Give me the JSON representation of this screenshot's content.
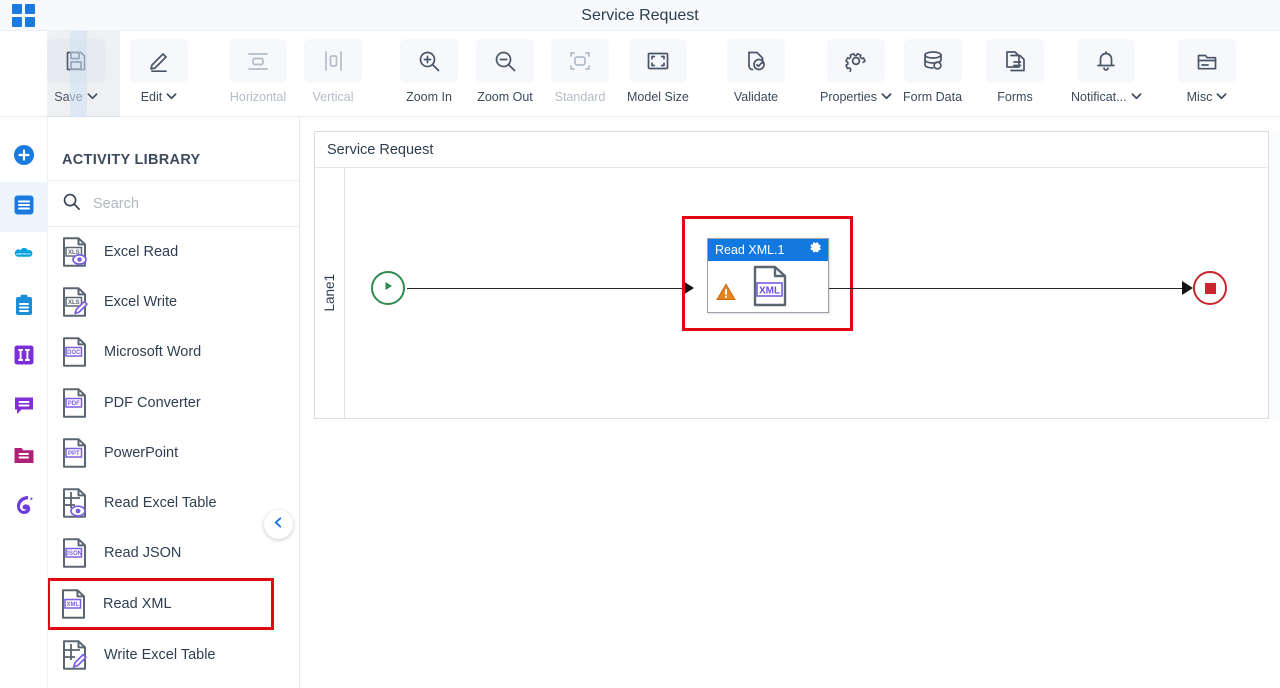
{
  "titlebar": {
    "app_icon": "grid-apps-icon",
    "title": "Service Request"
  },
  "toolbar": {
    "items": [
      {
        "id": "save",
        "label": "Save",
        "icon": "floppy-disk-icon",
        "caret": true,
        "disabled": false
      },
      {
        "id": "edit",
        "label": "Edit",
        "icon": "pencil-icon",
        "caret": true,
        "disabled": false
      },
      {
        "id": "horizontal",
        "label": "Horizontal",
        "icon": "horizontal-layout-icon",
        "caret": false,
        "disabled": true
      },
      {
        "id": "vertical",
        "label": "Vertical",
        "icon": "vertical-layout-icon",
        "caret": false,
        "disabled": true
      },
      {
        "id": "zoomin",
        "label": "Zoom In",
        "icon": "magnifier-plus-icon",
        "caret": false,
        "disabled": false
      },
      {
        "id": "zoomout",
        "label": "Zoom Out",
        "icon": "magnifier-minus-icon",
        "caret": false,
        "disabled": false
      },
      {
        "id": "standard",
        "label": "Standard",
        "icon": "standard-size-icon",
        "caret": false,
        "disabled": true
      },
      {
        "id": "modelsize",
        "label": "Model Size",
        "icon": "model-size-icon",
        "caret": false,
        "disabled": false
      },
      {
        "id": "validate",
        "label": "Validate",
        "icon": "document-check-icon",
        "caret": false,
        "disabled": false
      },
      {
        "id": "properties",
        "label": "Properties",
        "icon": "gear-icon",
        "caret": true,
        "disabled": false
      },
      {
        "id": "formdata",
        "label": "Form Data",
        "icon": "database-icon",
        "caret": false,
        "disabled": false
      },
      {
        "id": "forms",
        "label": "Forms",
        "icon": "copy-document-icon",
        "caret": false,
        "disabled": false
      },
      {
        "id": "notificat",
        "label": "Notificat...",
        "icon": "bell-icon",
        "caret": true,
        "disabled": false
      },
      {
        "id": "misc",
        "label": "Misc",
        "icon": "folder-misc-icon",
        "caret": true,
        "disabled": false
      }
    ]
  },
  "rail": {
    "items": [
      {
        "id": "add",
        "icon": "plus-circle-icon",
        "color": "#1b7ae0",
        "active": false
      },
      {
        "id": "activities",
        "icon": "list-square-icon",
        "color": "#1b7ae0",
        "active": true
      },
      {
        "id": "salesforce",
        "icon": "salesforce-cloud-icon",
        "color": "#00a1e0",
        "active": false
      },
      {
        "id": "clipboard",
        "icon": "clipboard-icon",
        "color": "#1b8ed6",
        "active": false
      },
      {
        "id": "columns",
        "icon": "two-columns-icon",
        "color": "#7b2fd4",
        "active": false
      },
      {
        "id": "messages",
        "icon": "chat-bubble-icon",
        "color": "#8230d6",
        "active": false
      },
      {
        "id": "folder",
        "icon": "folder-icon",
        "color": "#b01f78",
        "active": false
      },
      {
        "id": "branding",
        "icon": "swirl-logo-icon",
        "color": "#6c3ce0",
        "active": false
      }
    ]
  },
  "library": {
    "title": "ACTIVITY LIBRARY",
    "search": {
      "value": "",
      "placeholder": "Search",
      "icon": "search-icon"
    },
    "collapse_icon": "chevron-left-icon",
    "items": [
      {
        "label": "Excel Read",
        "icon": "xls-view-file-icon",
        "highlighted": false
      },
      {
        "label": "Excel Write",
        "icon": "xls-edit-file-icon",
        "highlighted": false
      },
      {
        "label": "Microsoft Word",
        "icon": "doc-file-icon",
        "highlighted": false
      },
      {
        "label": "PDF Converter",
        "icon": "pdf-file-icon",
        "highlighted": false
      },
      {
        "label": "PowerPoint",
        "icon": "ppt-file-icon",
        "highlighted": false
      },
      {
        "label": "Read Excel Table",
        "icon": "table-view-icon",
        "highlighted": false
      },
      {
        "label": "Read JSON",
        "icon": "json-file-icon",
        "highlighted": false
      },
      {
        "label": "Read XML",
        "icon": "xml-file-icon",
        "highlighted": true
      },
      {
        "label": "Write Excel Table",
        "icon": "table-edit-icon",
        "highlighted": false
      }
    ]
  },
  "canvas": {
    "pool_title": "Service Request",
    "lane_label": "Lane1",
    "start_node": {
      "name": "start-event",
      "icon": "play-triangle-icon",
      "color": "#2d8b4e"
    },
    "end_node": {
      "name": "end-event",
      "icon": "stop-square-icon",
      "color": "#c9252d"
    },
    "task": {
      "title": "Read XML.1",
      "header_color": "#1279e0",
      "gear_icon": "gear-icon",
      "body_icon": "xml-file-icon",
      "warning_icon": "warning-triangle-icon",
      "selected": true,
      "selection_color": "#e30613"
    }
  },
  "colors": {
    "accent_blue": "#1b7ae0",
    "selection_red": "#e30613",
    "task_header_blue": "#1279e0",
    "start_green": "#2d8b4e",
    "end_red": "#c9252d",
    "warning_orange": "#e8841a"
  }
}
